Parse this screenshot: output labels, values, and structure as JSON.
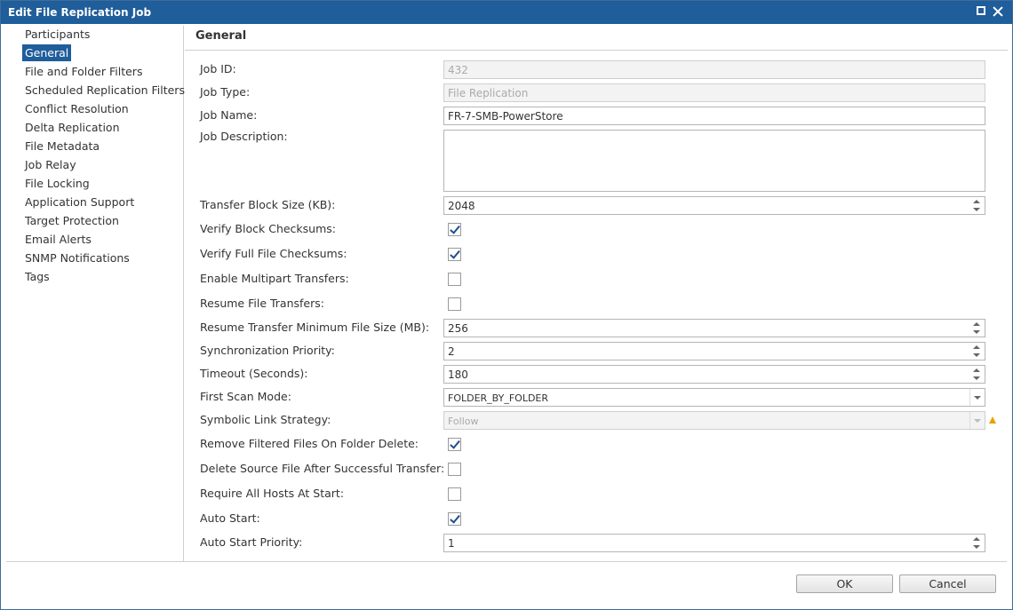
{
  "window": {
    "title": "Edit File Replication Job"
  },
  "sidebar": {
    "items": [
      {
        "label": "Participants",
        "selected": false
      },
      {
        "label": "General",
        "selected": true
      },
      {
        "label": "File and Folder Filters",
        "selected": false
      },
      {
        "label": "Scheduled Replication Filters",
        "selected": false
      },
      {
        "label": "Conflict Resolution",
        "selected": false
      },
      {
        "label": "Delta Replication",
        "selected": false
      },
      {
        "label": "File Metadata",
        "selected": false
      },
      {
        "label": "Job Relay",
        "selected": false
      },
      {
        "label": "File Locking",
        "selected": false
      },
      {
        "label": "Application Support",
        "selected": false
      },
      {
        "label": "Target Protection",
        "selected": false
      },
      {
        "label": "Email Alerts",
        "selected": false
      },
      {
        "label": "SNMP Notifications",
        "selected": false
      },
      {
        "label": "Tags",
        "selected": false
      }
    ]
  },
  "main": {
    "section_title": "General",
    "fields": {
      "job_id": {
        "label": "Job ID:",
        "value": "432"
      },
      "job_type": {
        "label": "Job Type:",
        "value": "File Replication"
      },
      "job_name": {
        "label": "Job Name:",
        "value": "FR-7-SMB-PowerStore"
      },
      "job_description": {
        "label": "Job Description:",
        "value": ""
      },
      "transfer_block_size": {
        "label": "Transfer Block Size (KB):",
        "value": "2048"
      },
      "verify_block_checksums": {
        "label": "Verify Block Checksums:",
        "checked": true
      },
      "verify_full_file_checksums": {
        "label": "Verify Full File Checksums:",
        "checked": true
      },
      "enable_multipart_transfers": {
        "label": "Enable Multipart Transfers:",
        "checked": false
      },
      "resume_file_transfers": {
        "label": "Resume File Transfers:",
        "checked": false
      },
      "resume_transfer_min_size": {
        "label": "Resume Transfer Minimum File Size (MB):",
        "value": "256"
      },
      "synchronization_priority": {
        "label": "Synchronization Priority:",
        "value": "2"
      },
      "timeout": {
        "label": "Timeout (Seconds):",
        "value": "180"
      },
      "first_scan_mode": {
        "label": "First Scan Mode:",
        "value": "FOLDER_BY_FOLDER"
      },
      "symbolic_link_strategy": {
        "label": "Symbolic Link Strategy:",
        "value": "Follow"
      },
      "remove_filtered_files": {
        "label": "Remove Filtered Files On Folder Delete:",
        "checked": true
      },
      "delete_source_file": {
        "label": "Delete Source File After Successful Transfer:",
        "checked": false
      },
      "require_all_hosts": {
        "label": "Require All Hosts At Start:",
        "checked": false
      },
      "auto_start": {
        "label": "Auto Start:",
        "checked": true
      },
      "auto_start_priority": {
        "label": "Auto Start Priority:",
        "value": "1"
      }
    }
  },
  "footer": {
    "ok_label": "OK",
    "cancel_label": "Cancel"
  },
  "colors": {
    "accent": "#1f5d9b",
    "warning": "#e8a000",
    "check": "#1f4f8a"
  }
}
